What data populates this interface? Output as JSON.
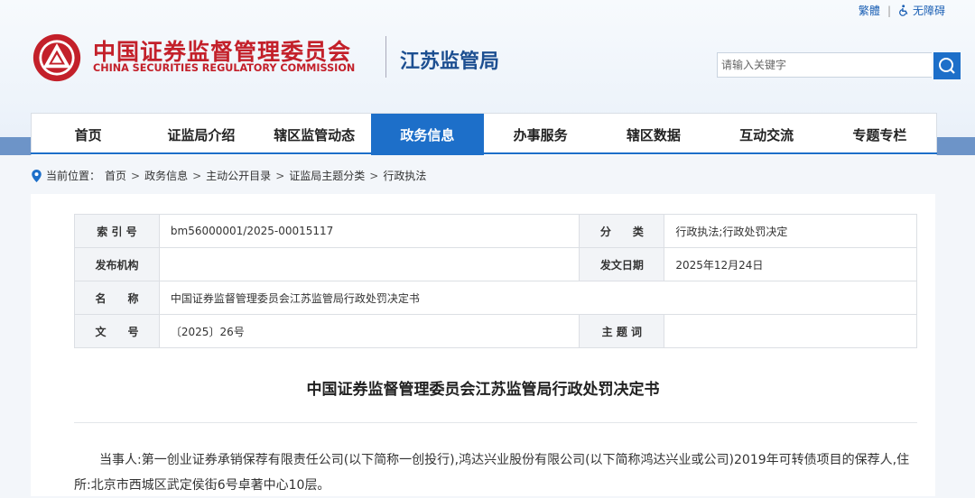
{
  "toplinks": {
    "traditional": "繁體",
    "separator": "|",
    "accessibility": "无障碍"
  },
  "header": {
    "cn_title": "中国证券监督管理委员会",
    "en_title": "CHINA SECURITIES REGULATORY COMMISSION",
    "sub_title": "江苏监管局",
    "logo_icon": "csrc-emblem-icon",
    "brand_color": "#c3202a",
    "accent_color": "#1d6fc9"
  },
  "search": {
    "placeholder": "请输入关键字",
    "icon": "search-icon"
  },
  "nav": {
    "items": [
      {
        "label": "首页"
      },
      {
        "label": "证监局介绍"
      },
      {
        "label": "辖区监管动态"
      },
      {
        "label": "政务信息",
        "active": true
      },
      {
        "label": "办事服务"
      },
      {
        "label": "辖区数据"
      },
      {
        "label": "互动交流"
      },
      {
        "label": "专题专栏"
      }
    ]
  },
  "breadcrumb": {
    "prefix": "当前位置：",
    "items": [
      "首页",
      "政务信息",
      "主动公开目录",
      "证监局主题分类",
      "行政执法"
    ],
    "separator": ">"
  },
  "meta": {
    "index_label": "索 引 号",
    "index_value": "bm56000001/2025-00015117",
    "category_label": "分　　类",
    "category_value": "行政执法;行政处罚决定",
    "publisher_label": "发布机构",
    "publisher_value": "",
    "date_label": "发文日期",
    "date_value": "2025年12月24日",
    "name_label": "名　　称",
    "name_value": "中国证券监督管理委员会江苏监管局行政处罚决定书",
    "docno_label": "文　　号",
    "docno_value": "〔2025〕26号",
    "subject_label": "主 题 词",
    "subject_value": ""
  },
  "document": {
    "title": "中国证券监督管理委员会江苏监管局行政处罚决定书",
    "paragraph": "当事人:第一创业证券承销保荐有限责任公司(以下简称一创投行),鸿达兴业股份有限公司(以下简称鸿达兴业或公司)2019年可转债项目的保荐人,住所:北京市西城区武定侯街6号卓著中心10层。"
  }
}
